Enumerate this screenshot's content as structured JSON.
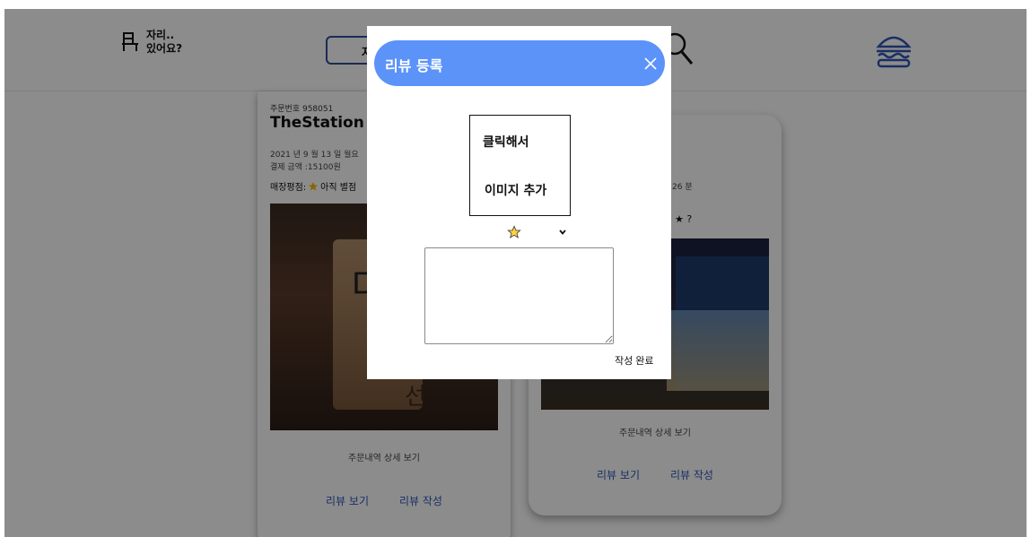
{
  "header": {
    "logo_line1": "자리..",
    "logo_line2": "있어요?",
    "search_partial": "자"
  },
  "order_left": {
    "order_no": "주문번호 958051",
    "store_name": "TheStation",
    "date": "2021 년 9 월 13 일 월요",
    "amount": "결제 금액 :15100원",
    "rating_label": "매장평점:",
    "rating_text": "아직 별점",
    "photo_sign_char": "디",
    "photo_sign_char2": "선",
    "detail_label": "주문내역 상세 보기",
    "view_review": "리뷰 보기",
    "write_review": "리뷰 작성"
  },
  "order_right": {
    "minute_text": "26 분",
    "rating_suffix": "★ ?",
    "detail_label": "주문내역 상세 보기",
    "view_review": "리뷰 보기",
    "write_review": "리뷰 작성"
  },
  "modal": {
    "title": "리뷰 등록",
    "image_line1": "클릭해서",
    "image_line2": "이미지 추가",
    "submit_label": "작성 완료",
    "accent_color": "#5b93f9"
  }
}
